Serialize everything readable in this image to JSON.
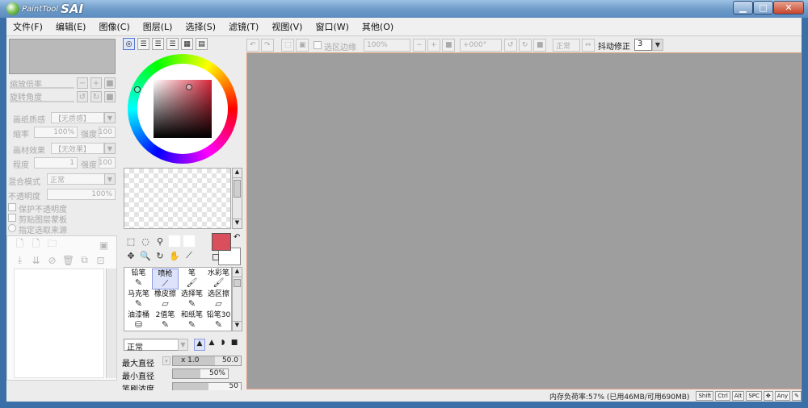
{
  "window": {
    "app_name": "PaintTool",
    "app_brand": "SAI",
    "minimize_glyph": "▁",
    "maximize_glyph": "□",
    "close_glyph": "✕"
  },
  "menu": [
    "文件(F)",
    "编辑(E)",
    "图像(C)",
    "图层(L)",
    "选择(S)",
    "滤镜(T)",
    "视图(V)",
    "窗口(W)",
    "其他(O)"
  ],
  "navigator": {
    "zoom_label": "缩放倍率",
    "rotate_label": "旋转角度"
  },
  "paper": {
    "texture_label": "画纸质感",
    "texture_value": "【无质感】",
    "scale_label": "缩率",
    "scale_value": "100%",
    "strength_label": "强度",
    "strength_value": "100",
    "effect_label": "画材效果",
    "effect_value": "【无效果】",
    "amount_label": "程度",
    "amount_value": "1",
    "effect_strength_label": "强度",
    "effect_strength_value": "100"
  },
  "layer_props": {
    "blend_label": "混合模式",
    "blend_value": "正常",
    "opacity_label": "不透明度",
    "opacity_value": "100%",
    "protect_label": "保护不透明度",
    "clip_label": "剪贴图层蒙板",
    "selsrc_label": "指定选取来源"
  },
  "color_tabs": [
    "wheel",
    "rgb",
    "hsv",
    "slider",
    "swatch",
    "scratch"
  ],
  "tools_label_group": {
    "brushes": [
      {
        "name": "铅笔",
        "icon": "pencil-icon"
      },
      {
        "name": "喷枪",
        "icon": "airbrush-icon",
        "selected": true
      },
      {
        "name": "笔",
        "icon": "brush-icon"
      },
      {
        "name": "水彩笔",
        "icon": "watercolor-icon"
      },
      {
        "name": "马克笔",
        "icon": "marker-icon"
      },
      {
        "name": "橡皮擦",
        "icon": "eraser-icon"
      },
      {
        "name": "选择笔",
        "icon": "select-pen-icon"
      },
      {
        "name": "选区擦",
        "icon": "select-eraser-icon"
      },
      {
        "name": "油漆桶",
        "icon": "bucket-icon"
      },
      {
        "name": "2值笔",
        "icon": "binary-pen-icon"
      },
      {
        "name": "和纸笔",
        "icon": "washi-pen-icon"
      },
      {
        "name": "铅笔30",
        "icon": "pencil-icon"
      }
    ]
  },
  "brush": {
    "mode_value": "正常",
    "max_size_label": "最大直径",
    "max_size_mult": "x 1.0",
    "max_size_value": "50.0",
    "min_size_label": "最小直径",
    "min_size_value": "50%",
    "min_size_fraction": 0.5,
    "density_label": "笔刷浓度",
    "density_value": "50"
  },
  "canvas_toolbar": {
    "sel_edge_label": "选区边缘",
    "zoom_value": "100%",
    "angle_value": "+000°",
    "mode_value": "正常",
    "stabilizer_label": "抖动修正",
    "stabilizer_value": "3"
  },
  "status": {
    "memory": "内存负荷率:57% (已用46MB/可用690MB)",
    "keys": [
      "Shift",
      "Ctrl",
      "Alt",
      "SPC",
      "✥",
      "Any",
      "✎"
    ]
  },
  "colors": {
    "primary": "#d94f5c",
    "secondary": "#ffffff",
    "canvas": "#9e9e9e"
  }
}
